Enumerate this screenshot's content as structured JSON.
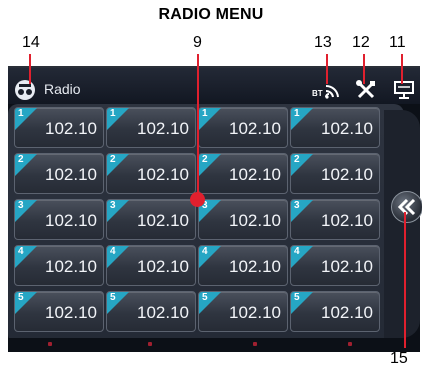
{
  "heading": "RADIO MENU",
  "callouts": {
    "n14": "14",
    "n9": "9",
    "n13": "13",
    "n12": "12",
    "n11": "11",
    "n15": "15"
  },
  "topbar": {
    "title": "Radio",
    "bt_label": "BT"
  },
  "icons": {
    "app": "radio-app-icon",
    "bluetooth": "bluetooth-icon",
    "tools": "settings-tools-icon",
    "display": "display-icon",
    "scroll": "double-chevron-left-icon"
  },
  "presets": [
    {
      "index": "1",
      "freq": "102.10"
    },
    {
      "index": "1",
      "freq": "102.10"
    },
    {
      "index": "1",
      "freq": "102.10"
    },
    {
      "index": "1",
      "freq": "102.10"
    },
    {
      "index": "2",
      "freq": "102.10"
    },
    {
      "index": "2",
      "freq": "102.10"
    },
    {
      "index": "2",
      "freq": "102.10"
    },
    {
      "index": "2",
      "freq": "102.10"
    },
    {
      "index": "3",
      "freq": "102.10"
    },
    {
      "index": "3",
      "freq": "102.10"
    },
    {
      "index": "3",
      "freq": "102.10"
    },
    {
      "index": "3",
      "freq": "102.10"
    },
    {
      "index": "4",
      "freq": "102.10"
    },
    {
      "index": "4",
      "freq": "102.10"
    },
    {
      "index": "4",
      "freq": "102.10"
    },
    {
      "index": "4",
      "freq": "102.10"
    },
    {
      "index": "5",
      "freq": "102.10"
    },
    {
      "index": "5",
      "freq": "102.10"
    },
    {
      "index": "5",
      "freq": "102.10"
    },
    {
      "index": "5",
      "freq": "102.10"
    }
  ],
  "colors": {
    "accent": "#26a6c4",
    "callout": "#e0202e"
  }
}
